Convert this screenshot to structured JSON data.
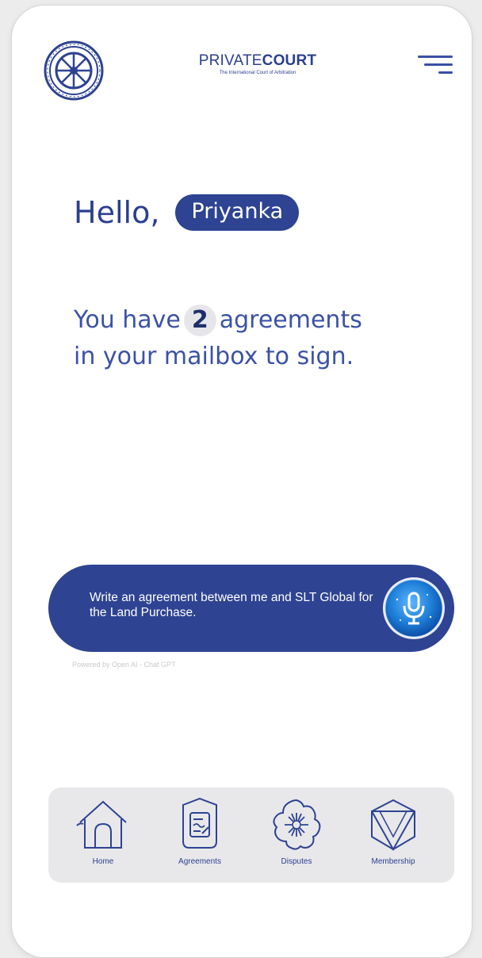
{
  "header": {
    "brand_regular": "PRIVATE",
    "brand_bold": "COURT",
    "brand_tagline": "The International Court of Arbitration",
    "logo_icon": "seal-wheel-icon",
    "menu_icon": "hamburger-menu-icon"
  },
  "greeting": {
    "hello": "Hello,",
    "user_name": "Priyanka"
  },
  "message": {
    "prefix": "You have",
    "count": "2",
    "suffix_line1": "agreements",
    "line2": "in your mailbox to sign."
  },
  "prompt": {
    "text": "Write an agreement between me and SLT Global  for the Land Purchase.",
    "mic_icon": "microphone-icon",
    "powered_by": "Powered by Open AI - Chat GPT"
  },
  "nav": {
    "items": [
      {
        "label": "Home",
        "icon": "home-icon"
      },
      {
        "label": "Agreements",
        "icon": "agreement-document-icon"
      },
      {
        "label": "Disputes",
        "icon": "dispute-burst-icon"
      },
      {
        "label": "Membership",
        "icon": "membership-cube-icon"
      }
    ]
  },
  "colors": {
    "primary": "#2e4392",
    "text_blue": "#3b52a6",
    "nav_bg": "#e8e8ea",
    "mic_blue": "#1e7fd8"
  }
}
